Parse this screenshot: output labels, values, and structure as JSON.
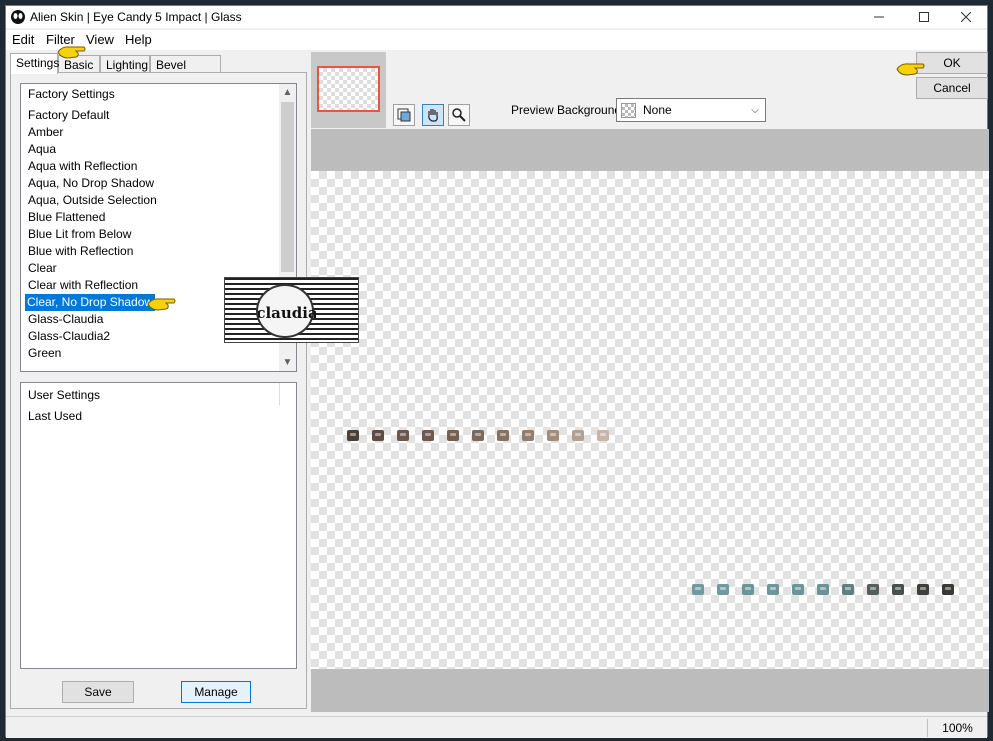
{
  "window": {
    "title": "Alien Skin | Eye Candy 5 Impact | Glass"
  },
  "menu": [
    "Edit",
    "Filter",
    "View",
    "Help"
  ],
  "tabs": [
    "Settings",
    "Basic",
    "Lighting",
    "Bevel Profile"
  ],
  "factory": {
    "header": "Factory Settings",
    "items": [
      "Factory Default",
      "Amber",
      "Aqua",
      "Aqua with Reflection",
      "Aqua, No Drop Shadow",
      "Aqua, Outside Selection",
      "Blue Flattened",
      "Blue Lit from Below",
      "Blue with Reflection",
      "Clear",
      "Clear with Reflection",
      "Clear, No Drop Shadow",
      "Glass-Claudia",
      "Glass-Claudia2",
      "Green"
    ],
    "selected": "Clear, No Drop Shadow"
  },
  "user": {
    "header": "User Settings",
    "items": [
      "Last Used"
    ]
  },
  "buttons": {
    "save": "Save",
    "manage": "Manage",
    "ok": "OK",
    "cancel": "Cancel"
  },
  "preview_background": {
    "label": "Preview Background:",
    "value": "None"
  },
  "status": {
    "zoom": "100%"
  },
  "colors": {
    "selection": "#0078d7",
    "thumbnail_border": "#e8544a",
    "beads_row1": [
      "#4a403a",
      "#5c4c42",
      "#6b584c",
      "#6d5a4e",
      "#75604f",
      "#7c6a5c",
      "#86715f",
      "#937d6c",
      "#a28c7c",
      "#b39f90",
      "#c6b5a8"
    ],
    "beads_row2": [
      "#6f9aa0",
      "#6f9aa0",
      "#6c9598",
      "#6e9598",
      "#6c9597",
      "#6b9295",
      "#60807f",
      "#545f5c",
      "#48504d",
      "#3f3f3b",
      "#3a3936"
    ]
  }
}
